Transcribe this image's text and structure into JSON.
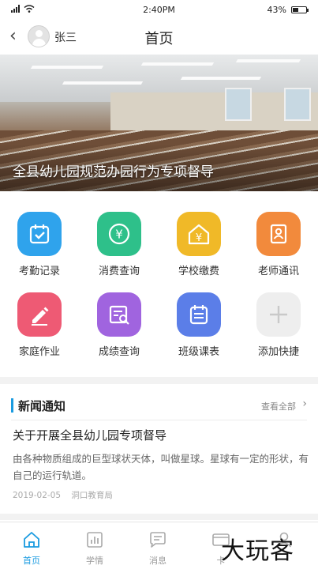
{
  "status_bar": {
    "time": "2:40PM",
    "battery": "43%",
    "battery_level": 0.43
  },
  "header": {
    "back_icon": "chevron-left-icon",
    "username": "张三",
    "title": "首页"
  },
  "banner": {
    "caption": "全县幼儿园规范办园行为专项督导"
  },
  "shortcuts": [
    {
      "label": "考勤记录",
      "icon": "calendar-check-icon",
      "color": "#2fa3ec"
    },
    {
      "label": "消费查询",
      "icon": "yuan-coin-icon",
      "color": "#2ec08a"
    },
    {
      "label": "学校缴费",
      "icon": "school-payment-icon",
      "color": "#f0b928"
    },
    {
      "label": "老师通讯",
      "icon": "contact-book-icon",
      "color": "#f28a3c"
    },
    {
      "label": "家庭作业",
      "icon": "pencil-icon",
      "color": "#ee5a74"
    },
    {
      "label": "成绩查询",
      "icon": "report-search-icon",
      "color": "#a064df"
    },
    {
      "label": "班级课表",
      "icon": "schedule-icon",
      "color": "#5b7ee8"
    },
    {
      "label": "添加快捷",
      "icon": "plus-icon",
      "color": "#eeeeee"
    }
  ],
  "news": {
    "section_title": "新闻通知",
    "view_all": "查看全部",
    "article": {
      "title": "关于开展全县幼儿园专项督导",
      "summary": "由各种物质组成的巨型球状天体，叫做星球。星球有一定的形状，有自己的运行轨道。",
      "date": "2019-02-05",
      "source": "洞口教育局"
    }
  },
  "tabbar": {
    "tabs": [
      {
        "label": "首页",
        "icon": "home-icon",
        "active": true
      },
      {
        "label": "学情",
        "icon": "chart-icon",
        "active": false
      },
      {
        "label": "消息",
        "icon": "message-icon",
        "active": false
      },
      {
        "label": "卡",
        "icon": "card-icon",
        "active": false
      },
      {
        "label": "",
        "icon": "profile-icon",
        "active": false
      }
    ]
  },
  "watermark": "大玩客",
  "colors": {
    "accent": "#1a9be0"
  }
}
